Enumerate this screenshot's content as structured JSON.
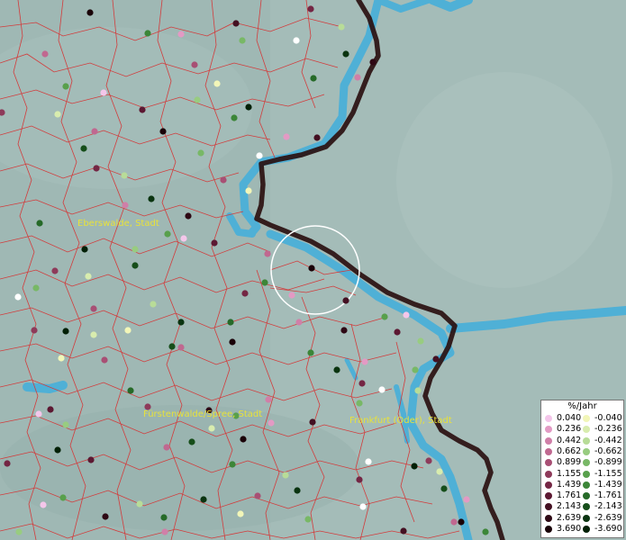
{
  "map": {
    "cities": [
      {
        "id": "eberswalde",
        "label": "Eberswalde, Stadt"
      },
      {
        "id": "fuerstenwalde",
        "label": "Fürstenwalde/Spree, Stadt"
      },
      {
        "id": "frankfurt-oder",
        "label": "Frankfurt (Oder), Stadt"
      }
    ],
    "colors": {
      "land": "#9fb8b4",
      "water": "#4fb0d6",
      "border": "#2a1010",
      "municipal_lines": "#d23c3c",
      "selection_circle": "#ffffff"
    }
  },
  "legend": {
    "title": "%/Jahr",
    "positive": [
      {
        "value": "0.040",
        "color": "#f4c6ea"
      },
      {
        "value": "0.236",
        "color": "#e39ac4"
      },
      {
        "value": "0.442",
        "color": "#d07fa8"
      },
      {
        "value": "0.662",
        "color": "#c06890"
      },
      {
        "value": "0.899",
        "color": "#a84f74"
      },
      {
        "value": "1.155",
        "color": "#8e3a5a"
      },
      {
        "value": "1.439",
        "color": "#742644"
      },
      {
        "value": "1.761",
        "color": "#5c1832"
      },
      {
        "value": "2.143",
        "color": "#441022"
      },
      {
        "value": "2.639",
        "color": "#2e0814"
      },
      {
        "value": "3.690",
        "color": "#1a0208"
      }
    ],
    "negative": [
      {
        "value": "-0.040",
        "color": "#f2f6b8"
      },
      {
        "value": "-0.236",
        "color": "#d8ecae"
      },
      {
        "value": "-0.442",
        "color": "#b8dc98"
      },
      {
        "value": "-0.662",
        "color": "#98cc80"
      },
      {
        "value": "-0.899",
        "color": "#78b866"
      },
      {
        "value": "-1.155",
        "color": "#58a04c"
      },
      {
        "value": "-1.439",
        "color": "#3c8638"
      },
      {
        "value": "-1.761",
        "color": "#266a28"
      },
      {
        "value": "-2.143",
        "color": "#164e1a"
      },
      {
        "value": "-2.639",
        "color": "#0a3410"
      },
      {
        "value": "-3.690",
        "color": "#022006"
      }
    ]
  }
}
